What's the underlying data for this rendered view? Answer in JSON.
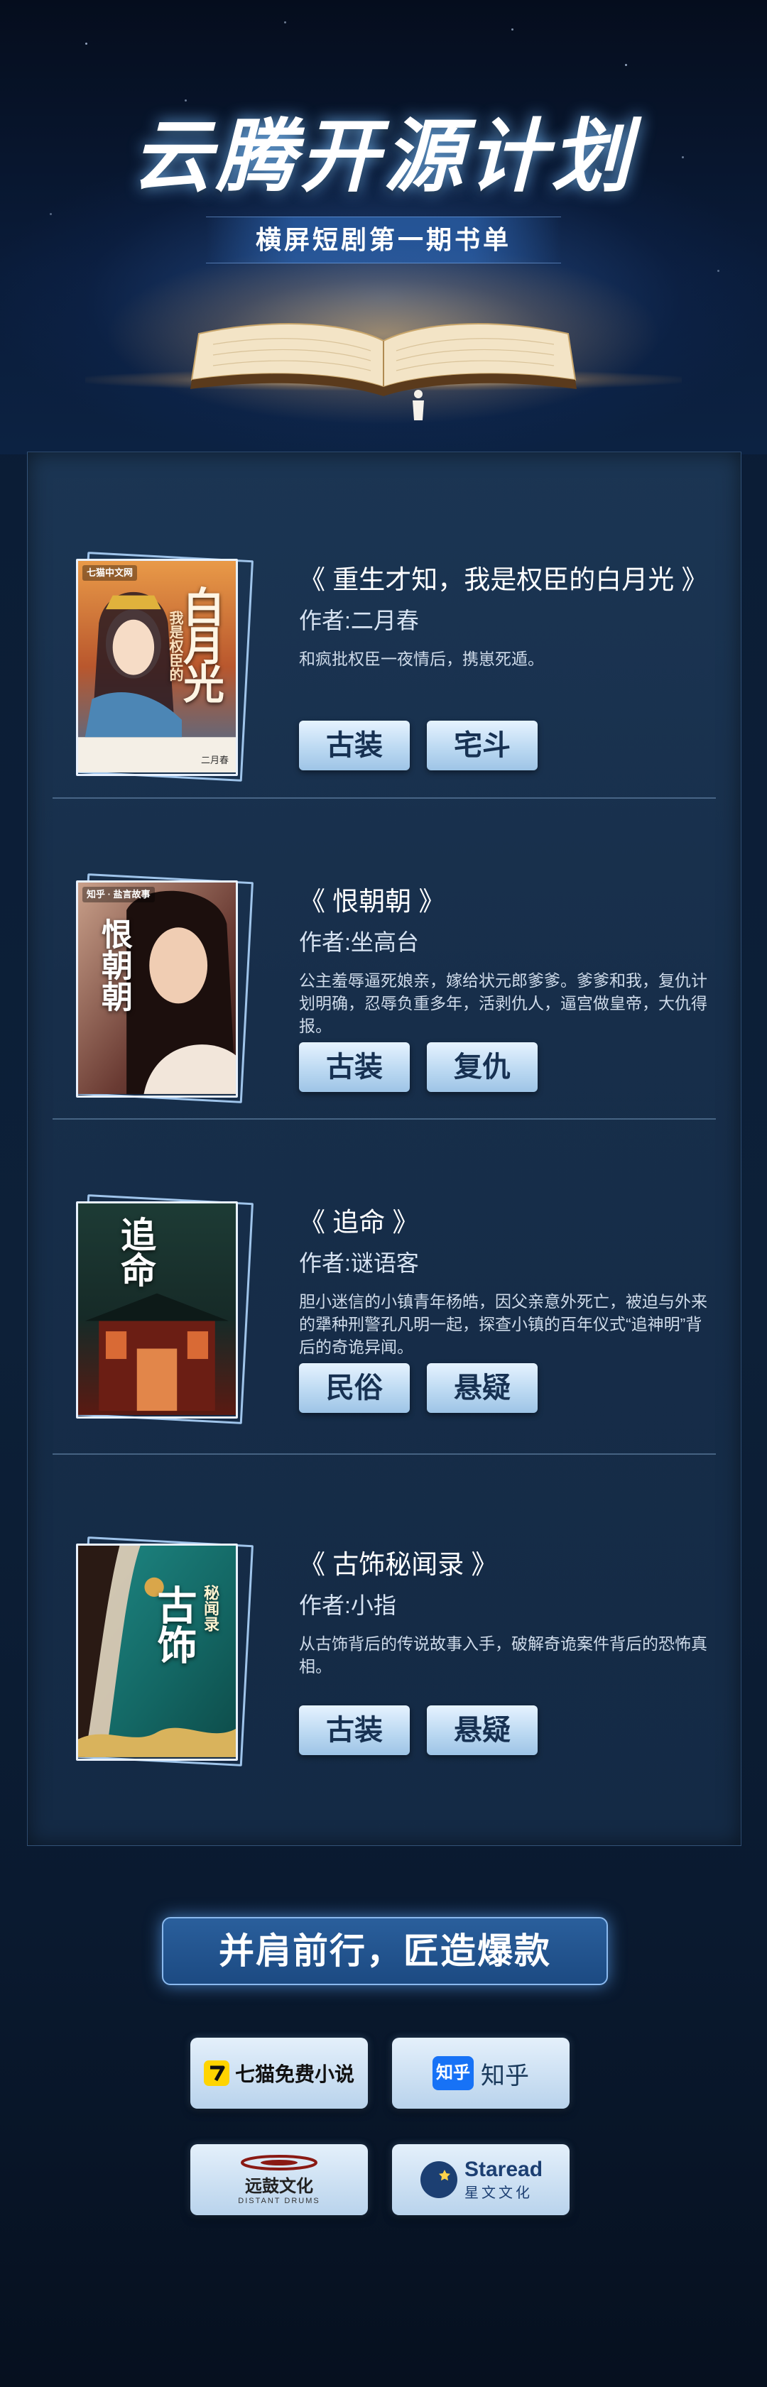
{
  "hero": {
    "title": "云腾开源计划",
    "subtitle": "横屏短剧第一期书单"
  },
  "books": [
    {
      "title": "《 重生才知，我是权臣的白月光 》",
      "author": "作者:二月春",
      "description": "和疯批权臣一夜情后，携崽死遁。",
      "tags": [
        "古装",
        "宅斗"
      ],
      "cover_title": "白月光",
      "cover_subtitle": "我是权臣的",
      "cover_brand": "七猫中文网",
      "cover_author": "二月春"
    },
    {
      "title": "《 恨朝朝 》",
      "author": "作者:坐高台",
      "description": "公主羞辱逼死娘亲，嫁给状元郎爹爹。爹爹和我，复仇计划明确，忍辱负重多年，活剥仇人，逼宫做皇帝，大仇得报。",
      "tags": [
        "古装",
        "复仇"
      ],
      "cover_title": "恨朝朝",
      "cover_brand": "知乎 · 盐言故事"
    },
    {
      "title": "《 追命 》",
      "author": "作者:谜语客",
      "description": "胆小迷信的小镇青年杨皓，因父亲意外死亡，被迫与外来的犟种刑警孔凡明一起，探查小镇的百年仪式“追神明”背后的奇诡异闻。",
      "tags": [
        "民俗",
        "悬疑"
      ],
      "cover_title": "追命"
    },
    {
      "title": "《 古饰秘闻录 》",
      "author": "作者:小指",
      "description": "从古饰背后的传说故事入手，破解奇诡案件背后的恐怖真相。",
      "tags": [
        "古装",
        "悬疑"
      ],
      "cover_title": "古饰",
      "cover_subtitle": "秘闻录"
    }
  ],
  "footer": {
    "slogan": "并肩前行，匠造爆款",
    "partners": [
      {
        "name": "七猫免费小说",
        "icon": "qimao-logo-icon"
      },
      {
        "name": "知乎",
        "badge": "知乎",
        "icon": "zhihu-logo-icon"
      },
      {
        "name": "远鼓文化",
        "subname": "DISTANT DRUMS",
        "icon": "distant-drums-logo-icon"
      },
      {
        "name": "Staread",
        "subname": "星文文化",
        "icon": "staread-logo-icon"
      }
    ]
  },
  "colors": {
    "background": "#0d2038",
    "panel": "#172e4a",
    "tag_text": "#173152",
    "tag_bg": "#bcd9f2",
    "slogan_bg": "#1c4a82"
  }
}
